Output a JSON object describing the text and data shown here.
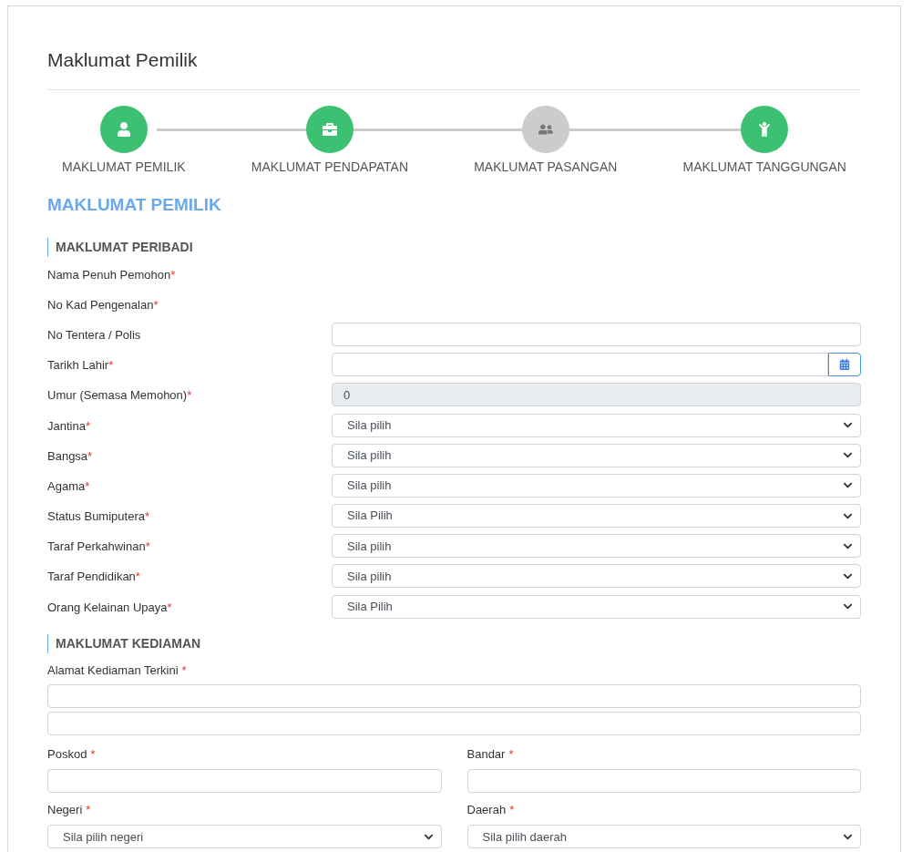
{
  "title": "Maklumat Pemilik",
  "steps": [
    {
      "label": "MAKLUMAT PEMILIK",
      "done": true
    },
    {
      "label": "MAKLUMAT PENDAPATAN",
      "done": true
    },
    {
      "label": "MAKLUMAT PASANGAN",
      "done": false
    },
    {
      "label": "MAKLUMAT TANGGUNGAN",
      "done": true
    }
  ],
  "section_title": "MAKLUMAT PEMILIK",
  "personal": {
    "heading": "MAKLUMAT PERIBADI",
    "fields": [
      {
        "label": "Nama Penuh Pemohon",
        "mark": "*",
        "kind": "none"
      },
      {
        "label": "No Kad Pengenalan",
        "mark": "*",
        "kind": "none"
      },
      {
        "label": "No Tentera / Polis",
        "kind": "text"
      },
      {
        "label": "Tarikh Lahir",
        "mark": "*",
        "kind": "date"
      },
      {
        "label": "Umur (Semasa Memohon)",
        "mark": "*",
        "kind": "readonly",
        "value": "0"
      },
      {
        "label": "Jantina",
        "mark": "*",
        "kind": "select",
        "value": "Sila pilih"
      },
      {
        "label": "Bangsa",
        "mark": "*",
        "kind": "select",
        "value": "Sila pilih"
      },
      {
        "label": "Agama",
        "mark": "*",
        "kind": "select",
        "value": "Sila pilih"
      },
      {
        "label": "Status Bumiputera",
        "mark": "*",
        "kind": "select",
        "value": "Sila Pilih"
      },
      {
        "label": "Taraf Perkahwinan",
        "mark": "*",
        "kind": "select",
        "value": "Sila pilih"
      },
      {
        "label": "Taraf Pendidikan",
        "mark": "*",
        "kind": "select",
        "value": "Sila pilih"
      },
      {
        "label": "Orang Kelainan Upaya",
        "mark": "*",
        "kind": "select",
        "value": "Sila Pilih"
      }
    ]
  },
  "residence": {
    "heading": "MAKLUMAT KEDIAMAN",
    "address": {
      "label": "Alamat Kediaman Terkini",
      "mark": "*"
    },
    "fields": [
      {
        "label": "Poskod",
        "mark": "*",
        "kind": "text"
      },
      {
        "label": "Bandar",
        "mark": "*",
        "kind": "text"
      },
      {
        "label": "Negeri",
        "mark": "*",
        "kind": "select",
        "value": "Sila pilih negeri"
      },
      {
        "label": "Daerah",
        "mark": "*",
        "kind": "select",
        "value": "Sila pilih daerah"
      }
    ]
  }
}
